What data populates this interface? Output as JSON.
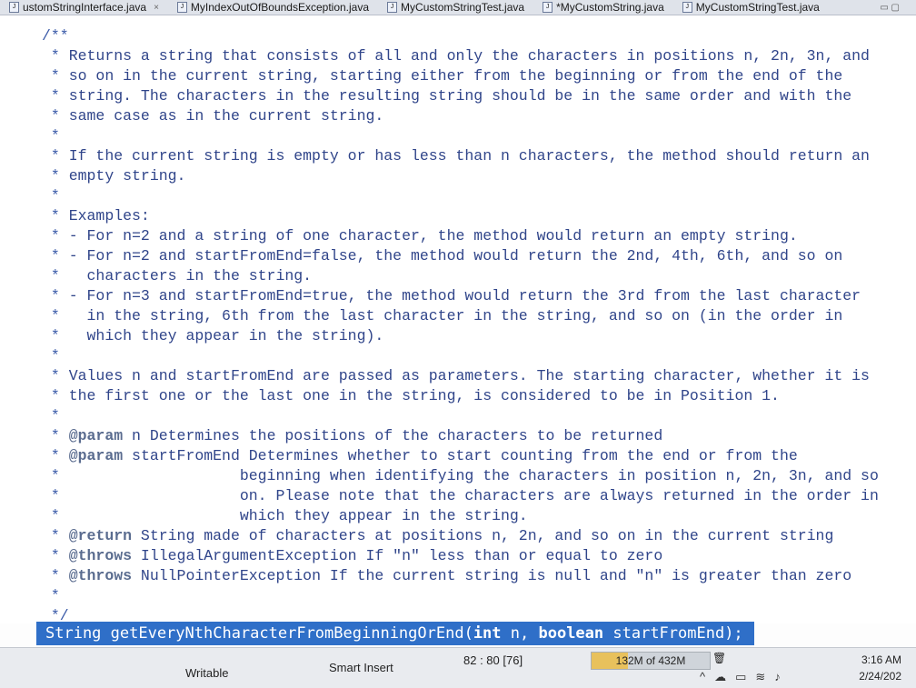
{
  "tabs": [
    {
      "label": "ustomStringInterface.java",
      "close": "×"
    },
    {
      "label": "MyIndexOutOfBoundsException.java",
      "close": ""
    },
    {
      "label": "MyCustomStringTest.java",
      "close": ""
    },
    {
      "label": "*MyCustomString.java",
      "close": ""
    },
    {
      "label": "MyCustomStringTest.java",
      "close": ""
    }
  ],
  "code_lines": [
    [
      {
        "c": "star",
        "t": "/**"
      }
    ],
    [
      {
        "c": "star",
        "t": " * "
      },
      {
        "c": "txt",
        "t": "Returns a string that consists of all and only the characters in positions n, 2n, 3n, and"
      }
    ],
    [
      {
        "c": "star",
        "t": " * "
      },
      {
        "c": "txt",
        "t": "so on in the current string, starting either from the beginning or from the end of the"
      }
    ],
    [
      {
        "c": "star",
        "t": " * "
      },
      {
        "c": "txt",
        "t": "string. The characters in the resulting string should be in the same order and with the"
      }
    ],
    [
      {
        "c": "star",
        "t": " * "
      },
      {
        "c": "txt",
        "t": "same case as in the current string."
      }
    ],
    [
      {
        "c": "star",
        "t": " *"
      }
    ],
    [
      {
        "c": "star",
        "t": " * "
      },
      {
        "c": "txt",
        "t": "If the current string is empty or has less than n characters, the method should return an"
      }
    ],
    [
      {
        "c": "star",
        "t": " * "
      },
      {
        "c": "txt",
        "t": "empty string."
      }
    ],
    [
      {
        "c": "star",
        "t": " *"
      }
    ],
    [
      {
        "c": "star",
        "t": " * "
      },
      {
        "c": "txt",
        "t": "Examples:"
      }
    ],
    [
      {
        "c": "star",
        "t": " * "
      },
      {
        "c": "txt",
        "t": "- For n=2 and a string of one character, the method would return an empty string."
      }
    ],
    [
      {
        "c": "star",
        "t": " * "
      },
      {
        "c": "txt",
        "t": "- For n=2 and startFromEnd=false, the method would return the 2nd, 4th, 6th, and so on"
      }
    ],
    [
      {
        "c": "star",
        "t": " * "
      },
      {
        "c": "txt",
        "t": "  characters in the string."
      }
    ],
    [
      {
        "c": "star",
        "t": " * "
      },
      {
        "c": "txt",
        "t": "- For n=3 and startFromEnd=true, the method would return the 3rd from the last character"
      }
    ],
    [
      {
        "c": "star",
        "t": " * "
      },
      {
        "c": "txt",
        "t": "  in the string, 6th from the last character in the string, and so on (in the order in"
      }
    ],
    [
      {
        "c": "star",
        "t": " * "
      },
      {
        "c": "txt",
        "t": "  which they appear in the string)."
      }
    ],
    [
      {
        "c": "star",
        "t": " *"
      }
    ],
    [
      {
        "c": "star",
        "t": " * "
      },
      {
        "c": "txt",
        "t": "Values n and startFromEnd are passed as parameters. The starting character, whether it is"
      }
    ],
    [
      {
        "c": "star",
        "t": " * "
      },
      {
        "c": "txt",
        "t": "the first one or the last one in the string, is considered to be in Position 1."
      }
    ],
    [
      {
        "c": "star",
        "t": " *"
      }
    ],
    [
      {
        "c": "star",
        "t": " * "
      },
      {
        "c": "tag",
        "t": "@param"
      },
      {
        "c": "txt",
        "t": " n Determines the positions of the characters to be returned"
      }
    ],
    [
      {
        "c": "star",
        "t": " * "
      },
      {
        "c": "tag",
        "t": "@param"
      },
      {
        "c": "txt",
        "t": " startFromEnd Determines whether to start counting from the end or from the"
      }
    ],
    [
      {
        "c": "star",
        "t": " * "
      },
      {
        "c": "txt",
        "t": "                   beginning when identifying the characters in position n, 2n, 3n, and so"
      }
    ],
    [
      {
        "c": "star",
        "t": " * "
      },
      {
        "c": "txt",
        "t": "                   on. Please note that the characters are always returned in the order in"
      }
    ],
    [
      {
        "c": "star",
        "t": " * "
      },
      {
        "c": "txt",
        "t": "                   which they appear in the string."
      }
    ],
    [
      {
        "c": "star",
        "t": " * "
      },
      {
        "c": "tag",
        "t": "@return"
      },
      {
        "c": "txt",
        "t": " String made of characters at positions n, 2n, and so on in the current string"
      }
    ],
    [
      {
        "c": "star",
        "t": " * "
      },
      {
        "c": "tag",
        "t": "@throws"
      },
      {
        "c": "txt",
        "t": " IllegalArgumentException If \"n\" less than or equal to zero"
      }
    ],
    [
      {
        "c": "star",
        "t": " * "
      },
      {
        "c": "tag",
        "t": "@throws"
      },
      {
        "c": "txt",
        "t": " NullPointerException If the current string is null and \"n\" is greater than zero"
      }
    ],
    [
      {
        "c": "star",
        "t": " *"
      }
    ],
    [
      {
        "c": "star",
        "t": " */"
      }
    ]
  ],
  "declaration": {
    "prefix": "String getEveryNthCharacterFromBeginningOrEnd(",
    "kw1": "int",
    "mid": " n, ",
    "kw2": "boolean",
    "suffix": " startFromEnd);"
  },
  "status": {
    "writable": "Writable",
    "insert_mode": "Smart Insert",
    "position": "82 : 80 [76]",
    "memory": "132M of 432M",
    "memory_fraction": 0.3056,
    "time": "3:16 AM",
    "date": "2/24/202"
  },
  "colors": {
    "selection": "#3478d4",
    "comment": "#30458a",
    "javadoc_tag": "#5a6c8f"
  }
}
